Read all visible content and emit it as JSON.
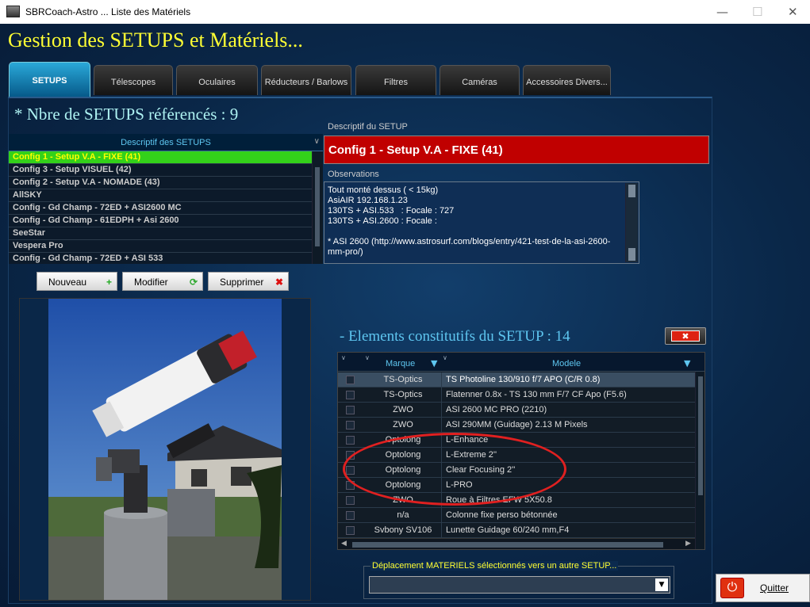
{
  "window": {
    "title": "SBRCoach-Astro ... Liste des Matériels",
    "minimize": "—",
    "maximize": "☐",
    "close": "✕"
  },
  "app_title": "Gestion des SETUPS et Matériels...",
  "tabs": [
    {
      "label": "SETUPS"
    },
    {
      "label": "Télescopes"
    },
    {
      "label": "Oculaires"
    },
    {
      "label": "Réducteurs / Barlows"
    },
    {
      "label": "Filtres"
    },
    {
      "label": "Caméras"
    },
    {
      "label": "Accessoires Divers..."
    }
  ],
  "setups": {
    "count_label": "*  Nbre de SETUPS référencés : 9",
    "list_header": "Descriptif des SETUPS",
    "items": [
      "Config 1 - Setup V.A - FIXE (41)",
      "Config 3 - Setup VISUEL (42)",
      "Config 2 - Setup V.A - NOMADE (43)",
      "AllSKY",
      "Config - Gd Champ - 72ED + ASI2600 MC",
      "Config - Gd Champ - 61EDPH + Asi 2600",
      "SeeStar",
      "Vespera Pro",
      "Config - Gd Champ - 72ED + ASI 533"
    ],
    "buttons": {
      "new": "Nouveau",
      "edit": "Modifier",
      "delete": "Supprimer"
    }
  },
  "detail": {
    "descriptif_label": "Descriptif du SETUP",
    "descriptif_value": "Config 1 - Setup V.A - FIXE (41)",
    "observations_label": "Observations",
    "observations": "Tout monté dessus ( < 15kg)\nAsiAIR 192.168.1.23\n130TS + ASI.533   : Focale : 727\n130TS + ASI.2600 : Focale :\n\n* ASI 2600 (http://www.astrosurf.com/blogs/entry/421-test-de-la-asi-2600-mm-pro/)"
  },
  "elements": {
    "title": "- Elements constitutifs du SETUP : 14",
    "columns": {
      "brand": "Marque",
      "model": "Modele"
    },
    "rows": [
      {
        "brand": "TS-Optics",
        "model": "TS Photoline 130/910 f/7 APO (C/R 0.8)"
      },
      {
        "brand": "TS-Optics",
        "model": "Flatenner 0.8x - TS 130 mm F/7 CF Apo (F5.6)"
      },
      {
        "brand": "ZWO",
        "model": "ASI 2600 MC PRO (2210)"
      },
      {
        "brand": "ZWO",
        "model": "ASI  290MM (Guidage) 2.13 M Pixels"
      },
      {
        "brand": "Optolong",
        "model": "L-Enhance"
      },
      {
        "brand": "Optolong",
        "model": "L-Extreme 2''"
      },
      {
        "brand": "Optolong",
        "model": "Clear Focusing 2''"
      },
      {
        "brand": "Optolong",
        "model": "L-PRO"
      },
      {
        "brand": "ZWO",
        "model": "Roue à Filtres EFW 5X50.8"
      },
      {
        "brand": "n/a",
        "model": "Colonne fixe perso bétonnée"
      },
      {
        "brand": "Svbony SV106",
        "model": "Lunette Guidage 60/240 mm,F4"
      }
    ]
  },
  "move": {
    "label": "Déplacement MATERIELS sélectionnés vers un autre SETUP...",
    "value": ""
  },
  "quit_label": "Quitter",
  "colors": {
    "accent_yellow": "#ffff33",
    "selected_green": "#33d11a",
    "setup_red": "#c00000",
    "header_cyan": "#5ec6f0",
    "highlight_ellipse": "#e02020"
  }
}
